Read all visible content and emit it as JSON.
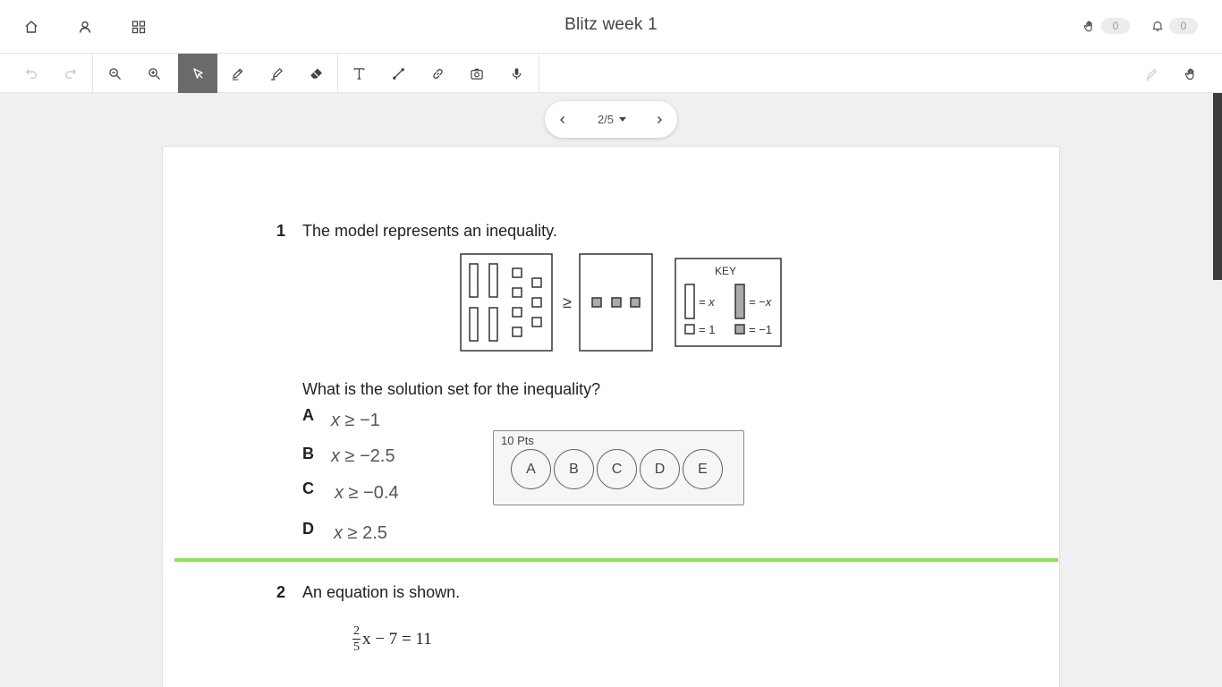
{
  "header": {
    "title": "Blitz week 1",
    "raised_hands_count": "0",
    "notifications_count": "0"
  },
  "pager": {
    "page_label": "2/5"
  },
  "question1": {
    "number": "1",
    "prompt": "The model represents an inequality.",
    "key_title": "KEY",
    "key_x": "= x",
    "key_neg_x": "= −x",
    "key_one": "= 1",
    "key_neg_one": "= −1",
    "inequality_symbol": "≥",
    "question": "What is the solution set for the inequality?",
    "choices": [
      {
        "letter": "A",
        "var": "x",
        "rest": " ≥ −1"
      },
      {
        "letter": "B",
        "var": "x",
        "rest": " ≥ −2.5"
      },
      {
        "letter": "C",
        "var": "x",
        "rest": " ≥ −0.4"
      },
      {
        "letter": "D",
        "var": "x",
        "rest": " ≥ 2.5"
      }
    ]
  },
  "answer_box": {
    "points": "10 Pts",
    "options": [
      "A",
      "B",
      "C",
      "D",
      "E"
    ]
  },
  "question2": {
    "number": "2",
    "prompt": "An equation is shown.",
    "frac_num": "2",
    "frac_den": "5",
    "equation_rest": "x − 7 = 11"
  }
}
